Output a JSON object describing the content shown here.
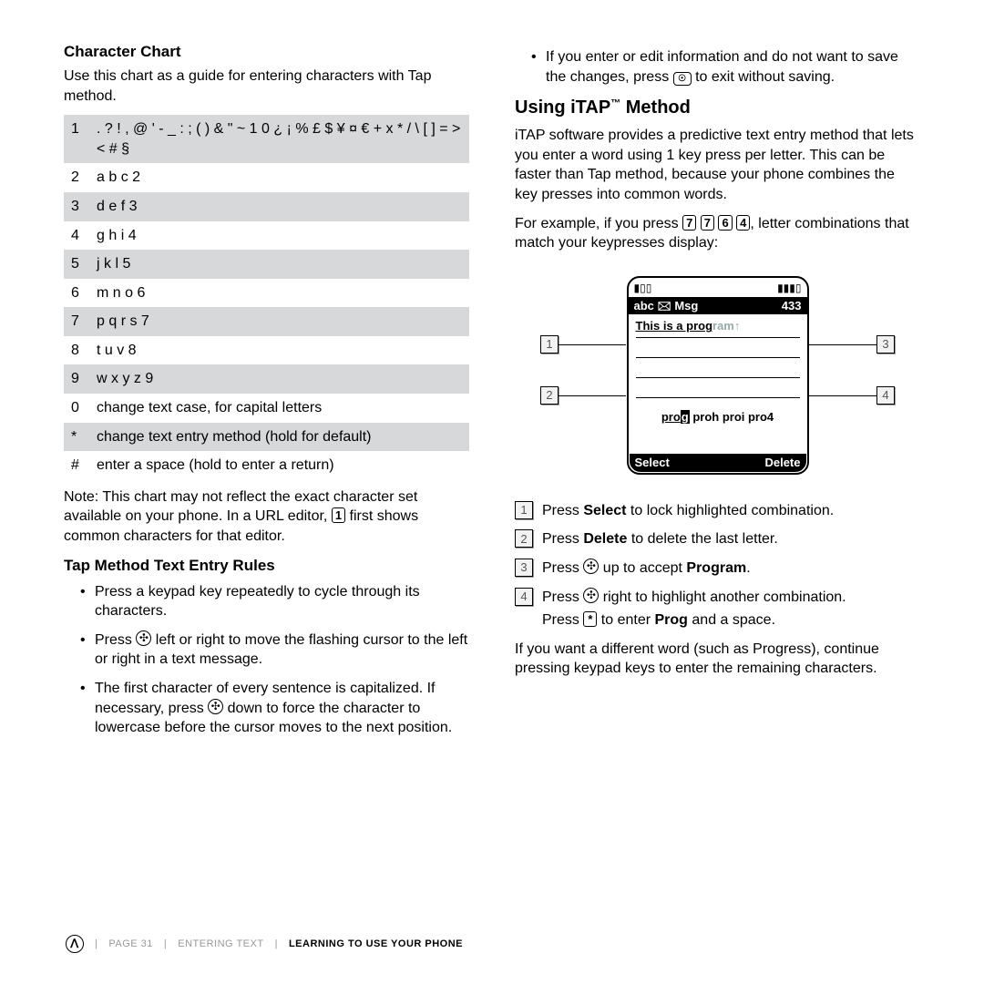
{
  "left": {
    "h_charChart": "Character Chart",
    "charChart_intro": "Use this chart as a guide for entering characters with Tap method.",
    "rows": [
      {
        "k": "1",
        "v": ". ? ! , @ ' - _ : ; ( ) & \" ~ 1 0 ¿ ¡ % £ $ ¥ ¤ € + x * / \\ [ ] = > < # §"
      },
      {
        "k": "2",
        "v": "a b c 2"
      },
      {
        "k": "3",
        "v": "d e f 3"
      },
      {
        "k": "4",
        "v": "g h i 4"
      },
      {
        "k": "5",
        "v": "j k l 5"
      },
      {
        "k": "6",
        "v": "m n o 6"
      },
      {
        "k": "7",
        "v": "p q r s 7"
      },
      {
        "k": "8",
        "v": "t u v 8"
      },
      {
        "k": "9",
        "v": "w x y z 9"
      },
      {
        "k": "0",
        "v": "change text case, for capital letters"
      },
      {
        "k": "*",
        "v": "change text entry method (hold for default)"
      },
      {
        "k": "#",
        "v": "enter a space (hold to enter a return)"
      }
    ],
    "note_a": "Note: This chart may not reflect the exact character set available on your phone. In a URL editor, ",
    "note_key": "1",
    "note_b": " first shows common characters for that editor.",
    "h_tapRules": "Tap Method Text Entry Rules",
    "rules": [
      "Press a keypad key repeatedly to cycle through its characters.",
      "Press   left or right to move the flashing cursor to the left or right in a text message.",
      "The first character of every sentence is capitalized. If necessary, press   down to force the character to lowercase before the cursor moves to the next position."
    ],
    "rule2_a": "Press ",
    "rule2_b": " left or right to move the flashing cursor to the left or right in a text message.",
    "rule3_a": "The first character of every sentence is capitalized. If necessary, press ",
    "rule3_b": " down to force the character to lowercase before the cursor moves to the next position."
  },
  "right": {
    "top_a": "If you enter or edit information and do not want to save the changes, press ",
    "top_key": "☉",
    "top_b": " to exit without saving.",
    "h_itap_a": "Using iTAP",
    "h_itap_tm": "™",
    "h_itap_b": " Method",
    "itap_intro": "iTAP software provides a predictive text entry method that lets you enter a word using 1 key press per letter. This can be faster than Tap method, because your phone combines the key presses into common words.",
    "example_a": "For example, if you press ",
    "keys": [
      "7",
      "7",
      "6",
      "4"
    ],
    "example_b": ", letter combinations that match your keypresses display:",
    "screen": {
      "bar_left": "abc 🖂 Msg",
      "bar_right": "433",
      "line1_typed": "This is a prog",
      "line1_ghost": "ram↑",
      "suggest_hl": "g",
      "suggest_pre": "pro",
      "suggest_rest": " proh proi pro4",
      "bottom_left": "Select",
      "bottom_right": "Delete"
    },
    "steps": {
      "s1_a": "Press ",
      "s1_bold": "Select",
      "s1_b": " to lock highlighted combination.",
      "s2_a": "Press ",
      "s2_bold": "Delete",
      "s2_b": " to delete the last letter.",
      "s3_a": "Press ",
      "s3_b": " up to accept ",
      "s3_bold": "Program",
      "s3_c": ".",
      "s4_a": "Press ",
      "s4_b": " right to highlight another combination.",
      "s4_sub_a": "Press ",
      "s4_sub_key": "*",
      "s4_sub_b": " to enter ",
      "s4_sub_bold": "Prog",
      "s4_sub_c": " and a space."
    },
    "closing": "If you want a different word (such as Progress), continue pressing keypad keys to enter the remaining characters."
  },
  "footer": {
    "page": "PAGE 31",
    "crumb1": "ENTERING TEXT",
    "crumb2": "LEARNING TO USE YOUR PHONE"
  }
}
